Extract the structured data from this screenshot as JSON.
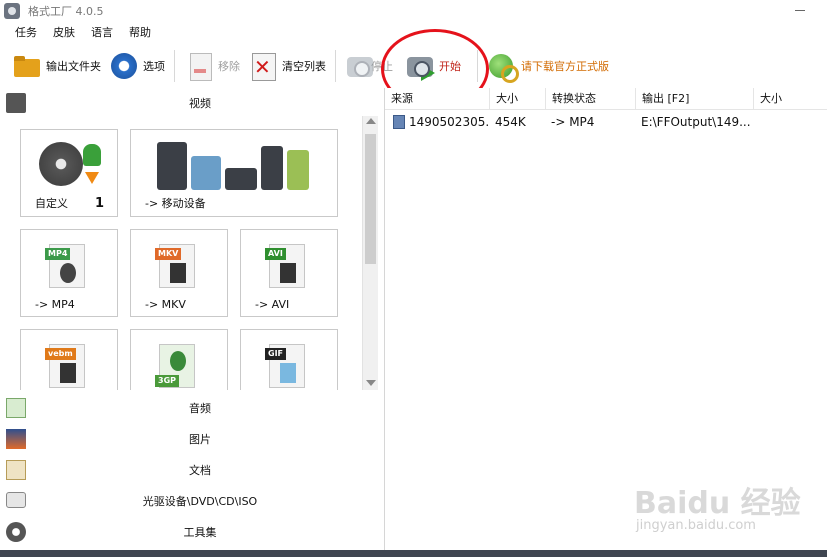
{
  "window": {
    "title": "格式工厂 4.0.5"
  },
  "menu": [
    "任务",
    "皮肤",
    "语言",
    "帮助"
  ],
  "toolbar": {
    "output_folder": "输出文件夹",
    "options": "选项",
    "remove": "移除",
    "clear_list": "清空列表",
    "stop": "停止",
    "start": "开始",
    "download": "请下载官方正式版"
  },
  "categories": {
    "video": "视频",
    "audio": "音频",
    "image": "图片",
    "document": "文档",
    "disc": "光驱设备\\DVD\\CD\\ISO",
    "tools": "工具集"
  },
  "tiles": [
    {
      "label": "自定义",
      "badge": "1"
    },
    {
      "label": "-> 移动设备"
    },
    {
      "label": "-> MP4",
      "tag": "MP4",
      "tag_color": "#3c9a4a"
    },
    {
      "label": "-> MKV",
      "tag": "MKV",
      "tag_color": "#e06a2a"
    },
    {
      "label": "-> AVI",
      "tag": "AVI",
      "tag_color": "#2f8f2f"
    },
    {
      "tag": "vebm",
      "tag_color": "#e07a1a"
    },
    {
      "tag": "3GP",
      "tag_color": "#4a9a3a"
    },
    {
      "tag": "GIF",
      "tag_color": "#222222"
    }
  ],
  "columns": [
    "来源",
    "大小",
    "转换状态",
    "输出 [F2]",
    "大小"
  ],
  "rows": [
    {
      "source": "1490502305...",
      "size": "454K",
      "status": "-> MP4",
      "output": "E:\\FFOutput\\149..."
    }
  ],
  "watermark": {
    "brand": "Baidu 经验",
    "url": "jingyan.baidu.com"
  }
}
